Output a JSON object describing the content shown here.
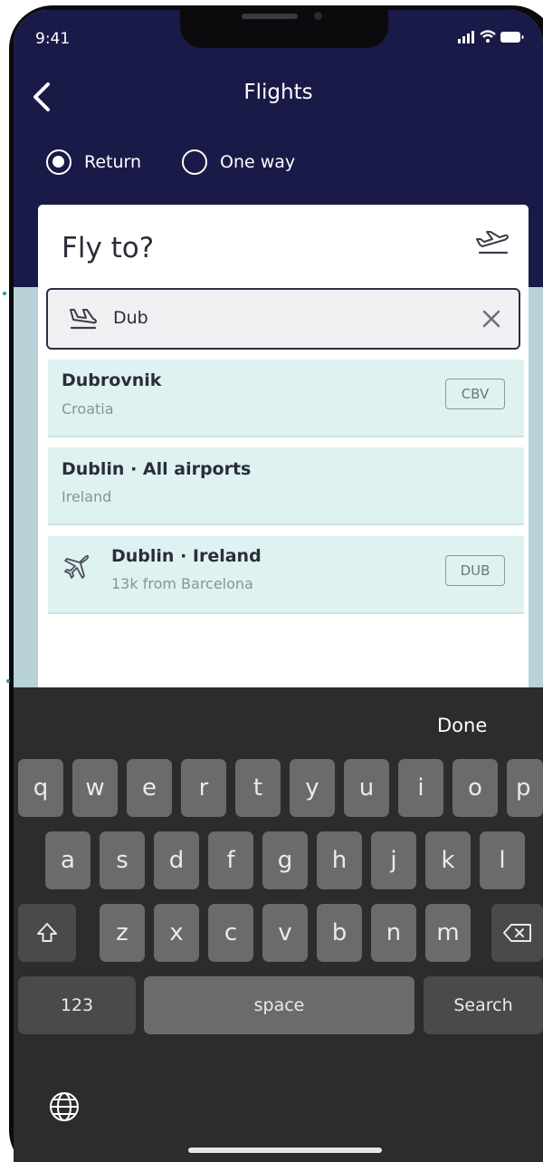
{
  "status_bar": {
    "time": "9:41"
  },
  "header": {
    "title": "Flights"
  },
  "trip_type": {
    "return_label": "Return",
    "one_way_label": "One way",
    "selected": "Return"
  },
  "card": {
    "title": "Fly to?"
  },
  "search": {
    "value": "Dub"
  },
  "results": [
    {
      "name": "Dubrovnik",
      "sub": "Croatia",
      "code": "CBV"
    },
    {
      "name": "Dublin · All airports",
      "sub": "Ireland"
    },
    {
      "name": "Dublin · Ireland",
      "sub": "13k from Barcelona",
      "code": "DUB"
    }
  ],
  "keyboard": {
    "done": "Done",
    "row1": [
      "q",
      "w",
      "e",
      "r",
      "t",
      "y",
      "u",
      "i",
      "o",
      "p"
    ],
    "row2": [
      "a",
      "s",
      "d",
      "f",
      "g",
      "h",
      "j",
      "k",
      "l"
    ],
    "row3": [
      "z",
      "x",
      "c",
      "v",
      "b",
      "n",
      "m"
    ],
    "numbers": "123",
    "space": "space",
    "search": "Search"
  },
  "colors": {
    "header_bg": "#1a1a48",
    "result_bg": "#def2f1",
    "keyboard_bg": "#2c2c2e"
  }
}
